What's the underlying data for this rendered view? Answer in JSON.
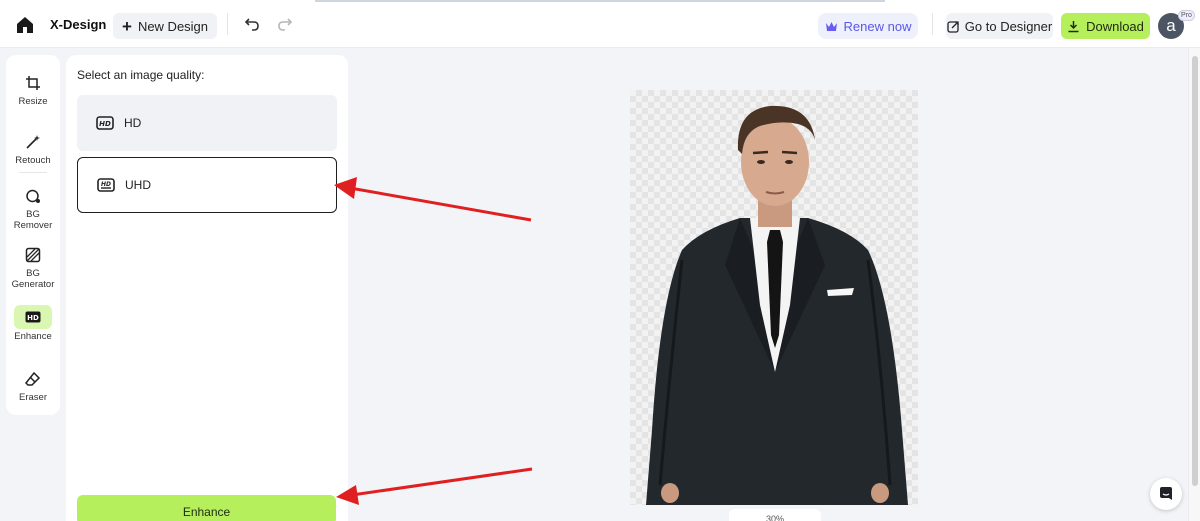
{
  "header": {
    "brand": "X-Design",
    "new_design": "New Design",
    "renew": "Renew now",
    "go_designer": "Go to Designer",
    "download": "Download",
    "avatar_letter": "a",
    "pro_badge": "Pro"
  },
  "tools": [
    {
      "label": "Resize",
      "icon": "crop-icon"
    },
    {
      "label": "Retouch",
      "icon": "magic-wand-icon"
    },
    {
      "label": "BG Remover",
      "icon": "bg-remover-icon"
    },
    {
      "label": "BG Generator",
      "icon": "hatched-square-icon"
    },
    {
      "label": "Enhance",
      "icon": "hd-icon",
      "active": true
    },
    {
      "label": "Eraser",
      "icon": "eraser-icon"
    }
  ],
  "panel": {
    "title": "Select an image quality:",
    "options": [
      {
        "label": "HD",
        "selected": false
      },
      {
        "label": "UHD",
        "selected": true
      }
    ],
    "enhance_button": "Enhance"
  },
  "canvas": {
    "zoom": "30%"
  },
  "colors": {
    "accent_green": "#b5ef5c",
    "renew_purple": "#5b57e8",
    "annotation_red": "#e02020"
  }
}
